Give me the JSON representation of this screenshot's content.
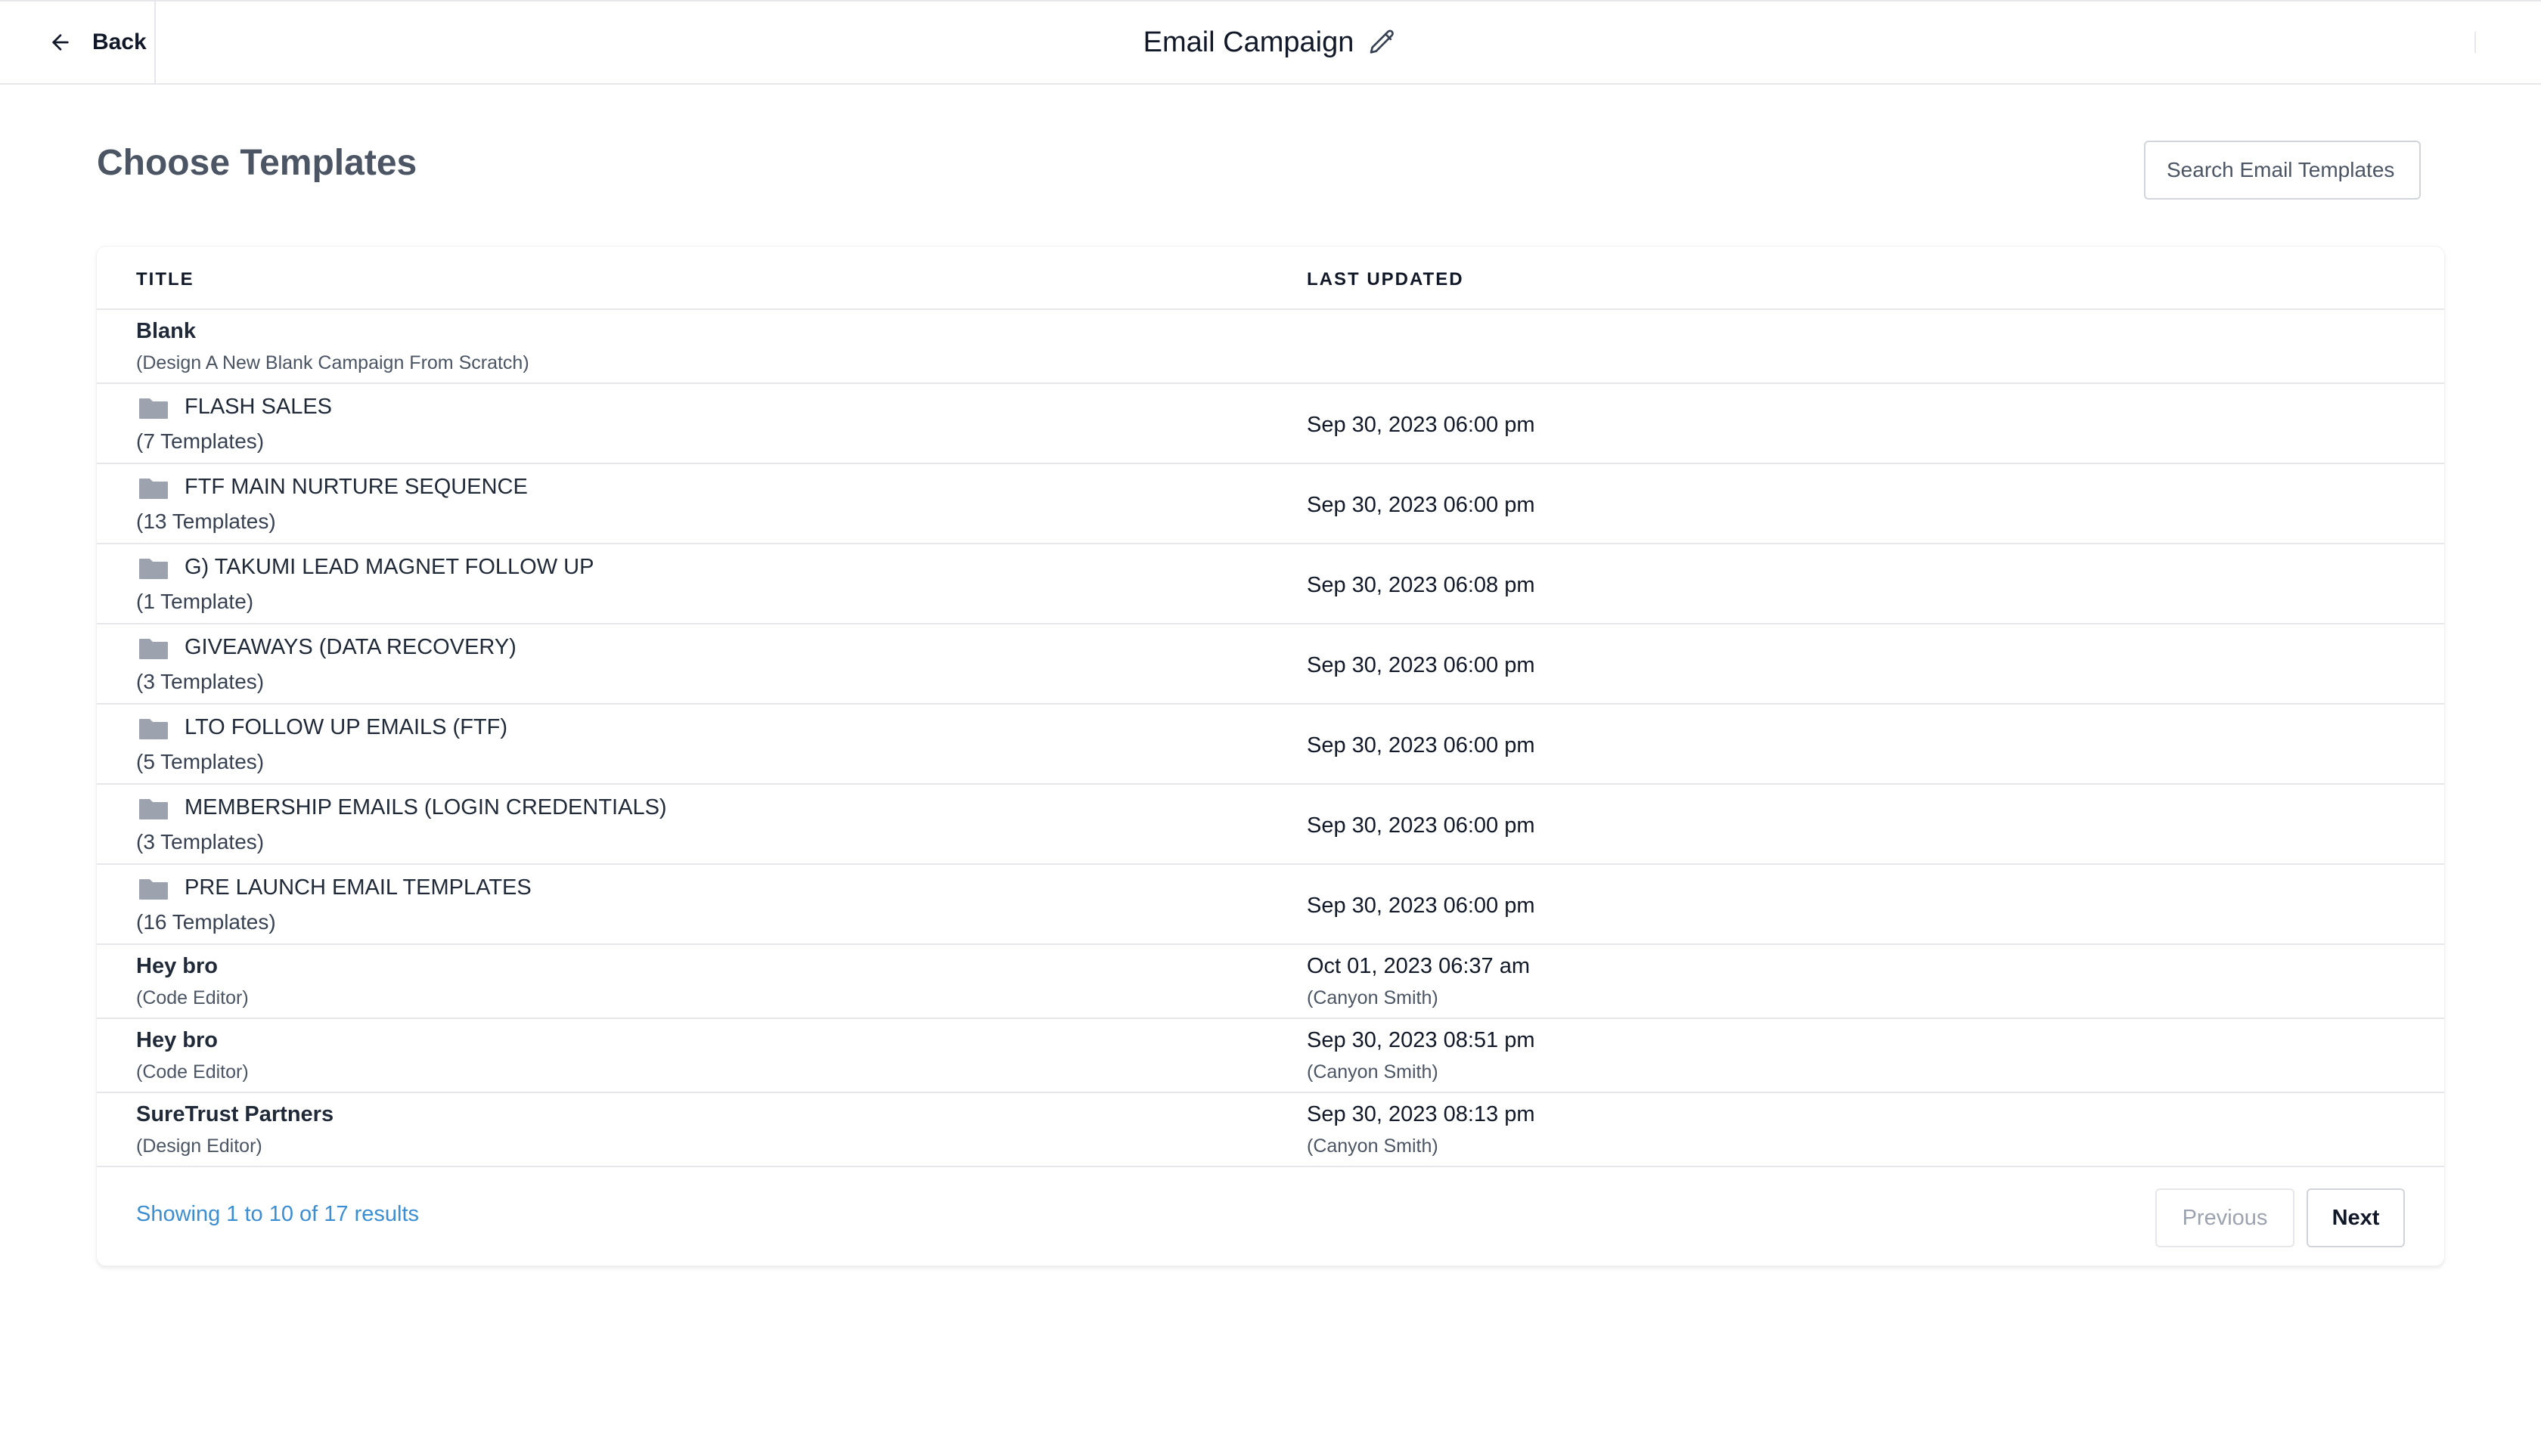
{
  "header": {
    "back_label": "Back",
    "campaign_title": "Email Campaign"
  },
  "page": {
    "title": "Choose Templates",
    "search_placeholder": "Search Email Templates"
  },
  "table": {
    "columns": [
      "TITLE",
      "LAST UPDATED"
    ],
    "rows": [
      {
        "type": "blank",
        "name": "Blank",
        "sub": "(Design A New Blank Campaign From Scratch)",
        "date": "",
        "author": ""
      },
      {
        "type": "folder",
        "name": "FLASH SALES",
        "sub": "(7 Templates)",
        "date": "Sep 30, 2023 06:00 pm",
        "author": ""
      },
      {
        "type": "folder",
        "name": "FTF MAIN NURTURE SEQUENCE",
        "sub": "(13 Templates)",
        "date": "Sep 30, 2023 06:00 pm",
        "author": ""
      },
      {
        "type": "folder",
        "name": "G) TAKUMI LEAD MAGNET FOLLOW UP",
        "sub": "(1 Template)",
        "date": "Sep 30, 2023 06:08 pm",
        "author": ""
      },
      {
        "type": "folder",
        "name": "GIVEAWAYS (DATA RECOVERY)",
        "sub": "(3 Templates)",
        "date": "Sep 30, 2023 06:00 pm",
        "author": ""
      },
      {
        "type": "folder",
        "name": "LTO FOLLOW UP EMAILS (FTF)",
        "sub": "(5 Templates)",
        "date": "Sep 30, 2023 06:00 pm",
        "author": ""
      },
      {
        "type": "folder",
        "name": "MEMBERSHIP EMAILS (LOGIN CREDENTIALS)",
        "sub": "(3 Templates)",
        "date": "Sep 30, 2023 06:00 pm",
        "author": ""
      },
      {
        "type": "folder",
        "name": "PRE LAUNCH EMAIL TEMPLATES",
        "sub": "(16 Templates)",
        "date": "Sep 30, 2023 06:00 pm",
        "author": ""
      },
      {
        "type": "template",
        "name": "Hey bro",
        "sub": "(Code Editor)",
        "date": "Oct 01, 2023 06:37 am",
        "author": "(Canyon Smith)"
      },
      {
        "type": "template",
        "name": "Hey bro",
        "sub": "(Code Editor)",
        "date": "Sep 30, 2023 08:51 pm",
        "author": "(Canyon Smith)"
      },
      {
        "type": "template",
        "name": "SureTrust Partners",
        "sub": "(Design Editor)",
        "date": "Sep 30, 2023 08:13 pm",
        "author": "(Canyon Smith)"
      }
    ]
  },
  "pagination": {
    "showing_text": "Showing 1 to 10 of 17 results",
    "previous_label": "Previous",
    "next_label": "Next"
  },
  "icons": {
    "back": "arrow-left-icon",
    "edit": "pencil-icon",
    "folder": "folder-icon"
  },
  "colors": {
    "link": "#3b8ed4",
    "folder_icon": "#9ca3af",
    "title": "#4b5563"
  }
}
